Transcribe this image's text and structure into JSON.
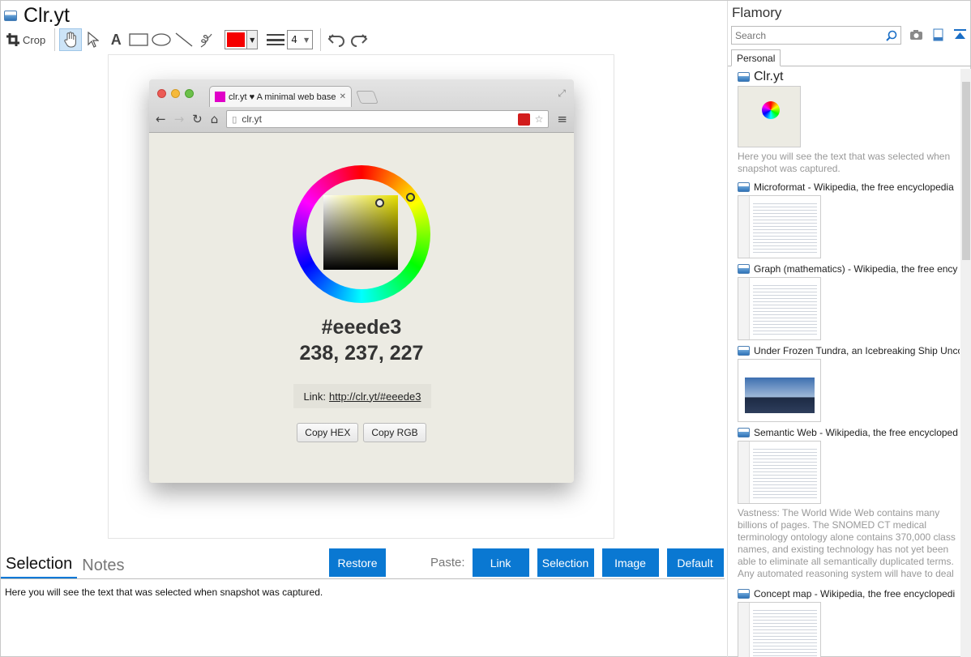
{
  "window": {
    "title": "Clr.yt"
  },
  "toolbar": {
    "crop_label": "Crop",
    "text_tool": "A",
    "line_width_value": "4",
    "color": "#f50000"
  },
  "browser": {
    "tab_title": "clr.yt ♥ A minimal web base",
    "url": "clr.yt",
    "hex": "#eeede3",
    "rgb": "238, 237, 227",
    "link_label": "Link:",
    "link_url": "http://clr.yt/#eeede3",
    "copy_hex": "Copy HEX",
    "copy_rgb": "Copy RGB"
  },
  "bottom": {
    "tab_selection": "Selection",
    "tab_notes": "Notes",
    "restore": "Restore",
    "paste_label": "Paste:",
    "paste_link": "Link",
    "paste_selection": "Selection",
    "paste_image": "Image",
    "paste_default": "Default",
    "selected_text": "Here you will see the text that was selected when snapshot was captured."
  },
  "sidebar": {
    "title": "Flamory",
    "search_placeholder": "Search",
    "tab": "Personal",
    "items": [
      {
        "title": "Clr.yt",
        "desc": "Here you will see the text that was selected when snapshot was captured."
      },
      {
        "title": "Microformat - Wikipedia, the free encyclopedia",
        "desc": ""
      },
      {
        "title": "Graph (mathematics) - Wikipedia, the free ency",
        "desc": ""
      },
      {
        "title": "Under Frozen Tundra, an Icebreaking Ship Unco",
        "desc": ""
      },
      {
        "title": "Semantic Web - Wikipedia, the free encycloped",
        "desc": "Vastness: The World Wide Web contains many billions of pages. The SNOMED CT medical terminology ontology alone contains 370,000 class names, and existing technology has not yet been able to eliminate all semantically duplicated terms. Any automated reasoning system will have to deal with truly huge inputs."
      },
      {
        "title": "Concept map - Wikipedia, the free encyclopedi",
        "desc": ""
      }
    ]
  }
}
